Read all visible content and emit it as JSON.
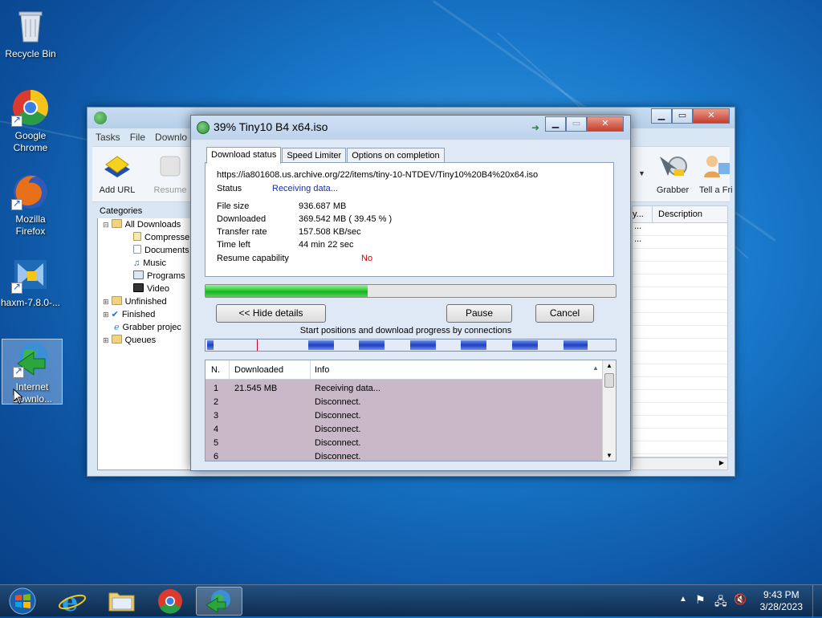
{
  "desktop": {
    "icons": [
      {
        "label": "Recycle Bin",
        "icon": "recycle-bin-icon"
      },
      {
        "label": "Google Chrome",
        "icon": "chrome-icon"
      },
      {
        "label": "Mozilla Firefox",
        "icon": "firefox-icon"
      },
      {
        "label": "haxm-7.8.0-...",
        "icon": "installer-icon"
      },
      {
        "label": "Internet Downlo...",
        "icon": "idm-icon"
      }
    ]
  },
  "idm_main": {
    "menu": [
      "Tasks",
      "File",
      "Downlo"
    ],
    "toolbar": {
      "add_url": "Add URL",
      "resume": "Resume",
      "grabber": "Grabber",
      "tell_friend": "Tell a Fri"
    },
    "categories": {
      "header": "Categories",
      "items": [
        "All Downloads",
        "Compresse",
        "Documents",
        "Music",
        "Programs",
        "Video",
        "Unfinished",
        "Finished",
        "Grabber projec",
        "Queues"
      ]
    },
    "list": {
      "col_partial": "y...",
      "col_description": "Description",
      "cell_1": "...",
      "cell_2": "..."
    }
  },
  "dialog": {
    "title": "39% Tiny10 B4 x64.iso",
    "tabs": [
      "Download status",
      "Speed Limiter",
      "Options on completion"
    ],
    "url": "https://ia801608.us.archive.org/22/items/tiny-10-NTDEV/Tiny10%20B4%20x64.iso",
    "status_label": "Status",
    "status_value": "Receiving data...",
    "file_size_label": "File size",
    "file_size_value": "936.687  MB",
    "downloaded_label": "Downloaded",
    "downloaded_value": "369.542  MB  ( 39.45 % )",
    "transfer_rate_label": "Transfer rate",
    "transfer_rate_value": "157.508  KB/sec",
    "time_left_label": "Time left",
    "time_left_value": "44 min 22 sec",
    "resume_label": "Resume capability",
    "resume_value": "No",
    "progress_percent": 39.45,
    "buttons": {
      "hide_details": "<< Hide details",
      "pause": "Pause",
      "cancel": "Cancel"
    },
    "connections_caption": "Start positions and download progress by connections",
    "table": {
      "headers": {
        "n": "N.",
        "downloaded": "Downloaded",
        "info": "Info"
      },
      "rows": [
        {
          "n": "1",
          "downloaded": "21.545  MB",
          "info": "Receiving data..."
        },
        {
          "n": "2",
          "downloaded": "",
          "info": "Disconnect."
        },
        {
          "n": "3",
          "downloaded": "",
          "info": "Disconnect."
        },
        {
          "n": "4",
          "downloaded": "",
          "info": "Disconnect."
        },
        {
          "n": "5",
          "downloaded": "",
          "info": "Disconnect."
        },
        {
          "n": "6",
          "downloaded": "",
          "info": "Disconnect."
        }
      ]
    }
  },
  "taskbar": {
    "items": [
      "start-orb",
      "internet-explorer-icon",
      "file-explorer-icon",
      "chrome-icon",
      "idm-icon"
    ],
    "time": "9:43 PM",
    "date": "3/28/2023"
  },
  "colors": {
    "progress_green": "#22c32a",
    "segment_blue": "#1b3fc3",
    "status_blue": "#1a2faa",
    "resume_red": "#cc0000"
  }
}
